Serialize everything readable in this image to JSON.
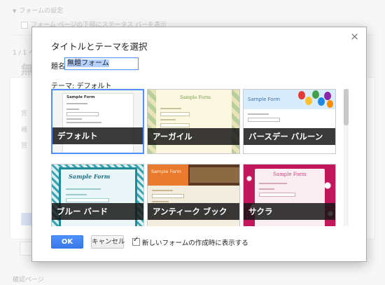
{
  "background": {
    "section_header": "フォームの設定",
    "checkbox_label": "フォーム ページの下部にステータス バーを表示",
    "page_indicator": "1 / 1 ペ",
    "form_title": "無",
    "confirm_label": "確認ページ"
  },
  "dialog": {
    "title": "タイトルとテーマを選択",
    "close_glyph": "×",
    "name_label": "題名",
    "name_value": "無題フォーム",
    "theme_label": "テーマ: デフォルト",
    "themes": [
      {
        "label": "デフォルト",
        "preview_title": "Sample Form",
        "selected": true
      },
      {
        "label": "アーガイル",
        "preview_title": "Sample Form",
        "selected": false
      },
      {
        "label": "バースデー バルーン",
        "preview_title": "Sample Form",
        "selected": false
      },
      {
        "label": "ブルー バード",
        "preview_title": "Sample Form",
        "selected": false
      },
      {
        "label": "アンティーク ブック",
        "preview_title": "Sample Form",
        "selected": false
      },
      {
        "label": "サクラ",
        "preview_title": "Sample Form",
        "selected": false
      }
    ],
    "ok_label": "OK",
    "cancel_label": "キャンセル",
    "show_on_create_label": "新しいフォームの作成時に表示する",
    "show_on_create_checked": true
  },
  "colors": {
    "accent": "#4d90fe",
    "ok_button": "#3e7ff2",
    "tile_label_bar": "#141414"
  }
}
